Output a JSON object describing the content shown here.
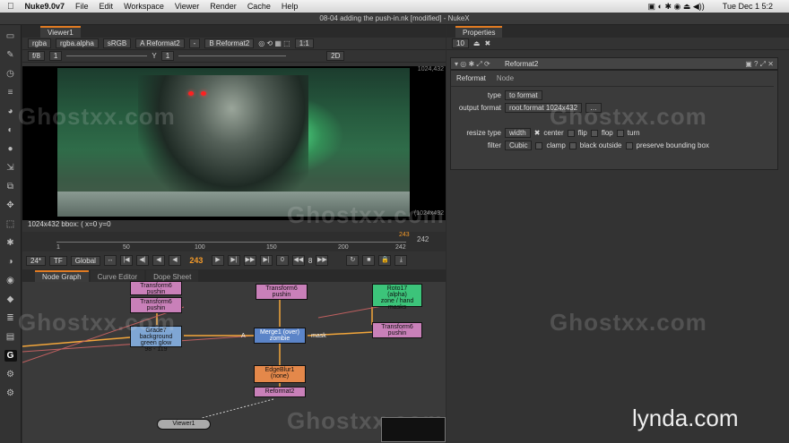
{
  "menubar": {
    "apple": "",
    "app": "Nuke9.0v7",
    "items": [
      "File",
      "Edit",
      "Workspace",
      "Viewer",
      "Render",
      "Cache",
      "Help"
    ],
    "clock": "Tue Dec 1  5:2"
  },
  "window_title": "08-04 adding the push-in.nk [modified] - NukeX",
  "viewer": {
    "tab": "Viewer1",
    "channels": "rgba",
    "alpha": "rgba.alpha",
    "colorspace": "sRGB",
    "input_a": "A  Reformat2",
    "input_b": "B  Reformat2",
    "ratio": "1:1",
    "fstop": "f/8",
    "gain": "1",
    "gamma_label": "Y",
    "gamma": "1",
    "mode_2d": "2D",
    "size_tr": "1024,432",
    "size_br": "(1024x432",
    "info": "1024x432  bbox: (  x=0 y=0"
  },
  "timeline": {
    "labels": [
      "1",
      "50",
      "100",
      "150",
      "200",
      "242"
    ],
    "end": "242",
    "current_label": "243"
  },
  "playback": {
    "fps": "24*",
    "tf": "TF",
    "range": "Global",
    "frame": "243",
    "step": "8",
    "zero": "0"
  },
  "graph": {
    "tabs": [
      "Node Graph",
      "Curve Editor",
      "Dope Sheet"
    ],
    "nodes": {
      "transform6a": "Transform6\npushin",
      "transform6b": "Transform6\npushin",
      "transform6c": "Transform6\npushin",
      "grade7": "Grade7\nbackground green glow\n98 - 119",
      "merge1": "Merge1 (over)\nzombie",
      "roto17": "Roto17\n(alpha)\nzone / hand masks",
      "edgeblur1": "EdgeBlur1\n(none)",
      "reformat2": "Reformat2",
      "viewer1": "Viewer1",
      "mask_label": "mask",
      "a_label": "A"
    }
  },
  "properties": {
    "tab": "Properties",
    "count": "10",
    "node_name": "Reformat2",
    "tabs": [
      "Reformat",
      "Node"
    ],
    "type_label": "type",
    "type_value": "to format",
    "output_format_label": "output format",
    "output_format_value": "root.format 1024x432",
    "resize_type_label": "resize type",
    "resize_type_value": "width",
    "center": "center",
    "flip": "flip",
    "flop": "flop",
    "turn": "turn",
    "filter_label": "filter",
    "filter_value": "Cubic",
    "clamp": "clamp",
    "black_outside": "black outside",
    "preserve_bbox": "preserve bounding box"
  },
  "watermark": "Ghostxx.com",
  "brand": "lynda.com"
}
